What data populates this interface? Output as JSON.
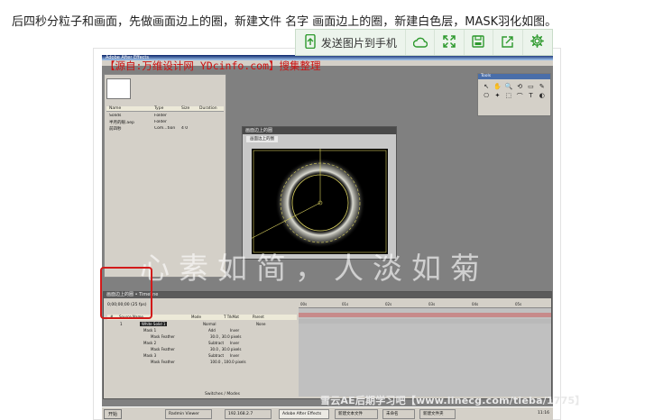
{
  "post": {
    "caption": "后四秒分粒子和画面，先做画面边上的圈，新建文件 名字 画面边上的圈，新建白色层，MASK羽化如图。"
  },
  "toolbar": {
    "send_label": "发送图片到手机",
    "buttons": [
      {
        "icon": "phone-send-icon"
      },
      {
        "icon": "cloud-icon"
      },
      {
        "icon": "fullscreen-icon"
      },
      {
        "icon": "save-icon"
      },
      {
        "icon": "share-icon"
      },
      {
        "icon": "settings-icon"
      }
    ],
    "accent_color": "#2e9a2e"
  },
  "screenshot": {
    "window_title": "Adobe After Effects",
    "source_text": "【源自:万维设计网 YDcinfo.com】搜集整理",
    "watermark": "心素如简，人淡如菊",
    "promo_text": "雪云AE后期学习吧【www.linecg.com/tieba/1775】",
    "project": {
      "columns": [
        "Name",
        "Type",
        "Size",
        "Duration"
      ],
      "rows": [
        {
          "name": "Solids",
          "type": "Folder"
        },
        {
          "name": "半月的眼.aep",
          "type": "Folder"
        },
        {
          "name": "前四秒",
          "type": "Com...tion",
          "size": "4 0"
        }
      ]
    },
    "tools": {
      "title": "Tools",
      "glyphs": [
        "↖",
        "✋",
        "🔍",
        "⟲",
        "▭",
        "✎",
        "⎔",
        "✦",
        "⬚",
        "⌒",
        "T",
        "◐"
      ]
    },
    "comp": {
      "window_title": "画面边上的圈",
      "tab_label": "画面边上的圈"
    },
    "timeline": {
      "title": "画面边上的圈 • Timeline",
      "current_time": "0;00;00;00 (25 fps)",
      "columns": [
        "#",
        "Source Name",
        "Mode",
        "T TrkMat",
        "Parent"
      ],
      "rows": [
        {
          "num": "1",
          "name": "White Solid 1",
          "mode": "Normal",
          "parent": "None"
        },
        {
          "name": "Mask 1",
          "mode": "Add",
          "value": "Inver"
        },
        {
          "name": "Mask Feather",
          "value": "30.0 , 30.0 pixels"
        },
        {
          "name": "Mask 2",
          "mode": "Subtract",
          "value": "Inver"
        },
        {
          "name": "Mask Feather",
          "value": "30.0 , 30.0 pixels"
        },
        {
          "name": "Mask 3",
          "mode": "Subtract",
          "value": "Inver"
        },
        {
          "name": "Mask Feather",
          "value": "100.0 , 100.0 pixels"
        }
      ],
      "ruler": [
        "00s",
        "01s",
        "02s",
        "03s",
        "04s",
        "05s"
      ],
      "footer": "Switches / Modes"
    },
    "taskbar": {
      "start": "开始",
      "tasks": [
        "Radmin Viewer",
        "192.168.2.7",
        "Adobe After Effects",
        "新建文本文件",
        "未命名",
        "新建文件夹"
      ],
      "clock": "11:16"
    }
  }
}
